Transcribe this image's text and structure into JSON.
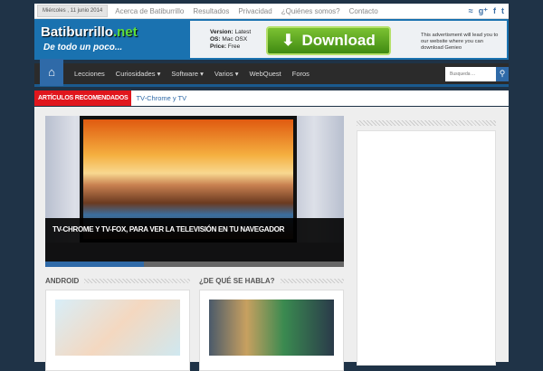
{
  "topbar": {
    "date": "Miércoles , 11 junio 2014",
    "links": [
      "Acerca de Batiburrillo",
      "Resultados",
      "Privacidad",
      "¿Quiénes somos?",
      "Contacto"
    ],
    "social_icons": [
      "rss-icon",
      "google-plus-icon",
      "facebook-icon",
      "twitter-icon"
    ]
  },
  "header": {
    "logo_main": "Batiburrillo",
    "logo_tld": ".net",
    "tagline": "De todo un poco...",
    "ad": {
      "version_label": "Version:",
      "version": "Latest",
      "os_label": "OS:",
      "os": "Mac OSX",
      "price_label": "Price:",
      "price": "Free",
      "download": "Download",
      "text": "This advertisment will lead you to our website where you can download Genieo"
    }
  },
  "nav": {
    "items": [
      "Lecciones",
      "Curiosidades",
      "Software",
      "Varios",
      "WebQuest",
      "Foros"
    ],
    "search_placeholder": "Busqueda ..."
  },
  "ticker": {
    "label": "ARTÍCULOS RECOMENDADOS",
    "item": "TV-Chrome y TV"
  },
  "slider": {
    "caption": "TV-CHROME Y TV-FOX, PARA VER LA TELEVISIÓN EN TU NAVEGADOR",
    "progress_percent": 33
  },
  "sections": [
    {
      "title": "ANDROID"
    },
    {
      "title": "¿DE QUÉ SE HABLA?"
    }
  ],
  "colors": {
    "background": "#1f3347",
    "accent": "#2f6aa8",
    "ticker_red": "#e0161d"
  }
}
